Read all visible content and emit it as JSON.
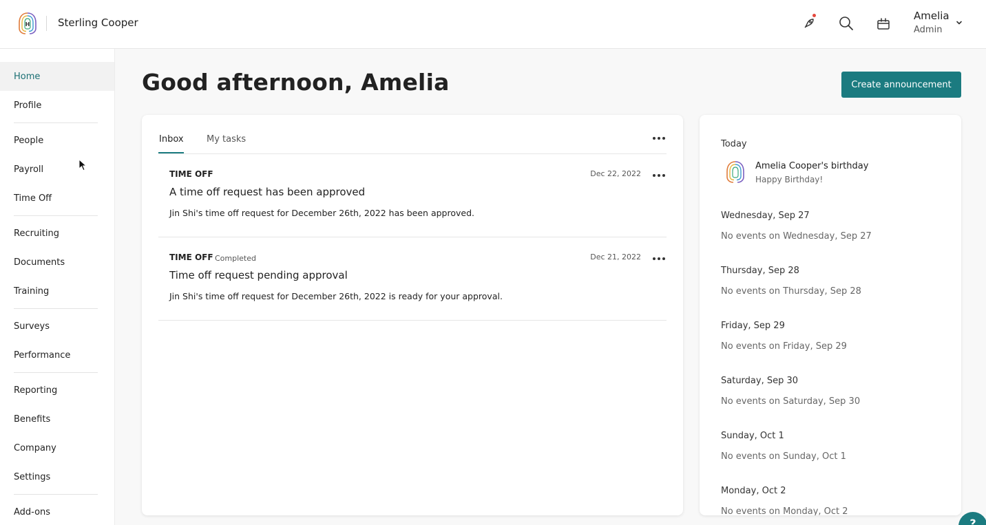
{
  "header": {
    "company": "Sterling Cooper",
    "user": {
      "name": "Amelia",
      "role": "Admin"
    }
  },
  "sidebar": {
    "items": [
      {
        "label": "Home",
        "active": true
      },
      {
        "label": "Profile"
      },
      {
        "label": "People"
      },
      {
        "label": "Payroll"
      },
      {
        "label": "Time Off"
      },
      {
        "label": "Recruiting"
      },
      {
        "label": "Documents"
      },
      {
        "label": "Training"
      },
      {
        "label": "Surveys"
      },
      {
        "label": "Performance"
      },
      {
        "label": "Reporting"
      },
      {
        "label": "Benefits"
      },
      {
        "label": "Company"
      },
      {
        "label": "Settings"
      },
      {
        "label": "Add-ons"
      }
    ]
  },
  "main": {
    "greeting": "Good afternoon, Amelia",
    "create_button": "Create announcement",
    "tabs": [
      {
        "label": "Inbox",
        "active": true
      },
      {
        "label": "My tasks"
      }
    ],
    "messages": [
      {
        "category": "TIME OFF",
        "status": "",
        "date": "Dec 22, 2022",
        "title": "A time off request has been approved",
        "body": "Jin Shi's time off request for December 26th, 2022 has been approved."
      },
      {
        "category": "TIME OFF",
        "status": "Completed",
        "date": "Dec 21, 2022",
        "title": "Time off request pending approval",
        "body": "Jin Shi's time off request for December 26th, 2022 is ready for your approval."
      }
    ]
  },
  "events": {
    "today_label": "Today",
    "birthday": {
      "title": "Amelia Cooper's birthday",
      "subtitle": "Happy Birthday!"
    },
    "days": [
      {
        "day": "Wednesday, Sep 27",
        "text": "No events on Wednesday, Sep 27"
      },
      {
        "day": "Thursday, Sep 28",
        "text": "No events on Thursday, Sep 28"
      },
      {
        "day": "Friday, Sep 29",
        "text": "No events on Friday, Sep 29"
      },
      {
        "day": "Saturday, Sep 30",
        "text": "No events on Saturday, Sep 30"
      },
      {
        "day": "Sunday, Oct 1",
        "text": "No events on Sunday, Oct 1"
      },
      {
        "day": "Monday, Oct 2",
        "text": "No events on Monday, Oct 2"
      }
    ]
  },
  "help": {
    "label": "?"
  },
  "colors": {
    "accent": "#1b7b80",
    "notification": "#e5483d",
    "active_nav_bg": "#f2f2f2"
  },
  "icons": [
    "rocket-icon",
    "search-icon",
    "gift-icon",
    "chevron-down-icon",
    "more-icon",
    "cursor-icon",
    "logo-icon"
  ]
}
